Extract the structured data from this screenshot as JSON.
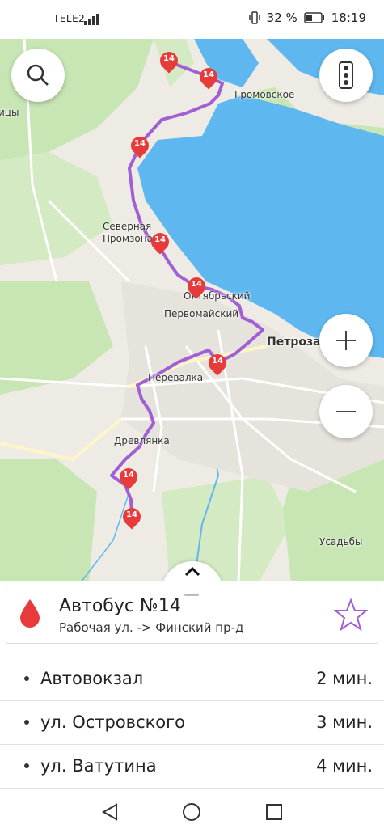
{
  "status_bar": {
    "carrier": "TELE2",
    "battery": "32 %",
    "time": "18:19"
  },
  "map": {
    "labels": {
      "gromovskoe": "Громовское",
      "severnaya_1": "Северная",
      "severnaya_2": "Промзона",
      "oktyabrsky": "Октябрьский",
      "pervomaysky": "Первомайский",
      "petrozavodsk": "Петрозаводск",
      "perevalka": "Перевалка",
      "drevlyanka": "Древлянка",
      "usadby": "Усадьбы",
      "left_edge": "ицы"
    },
    "stop_number": "14",
    "colors": {
      "water": "#5fb7f0",
      "land": "#eeebe5",
      "forest": "#c7e6b4",
      "route": "#a15fd6",
      "stop": "#e73a3a"
    }
  },
  "route_card": {
    "title": "Автобус №14",
    "subtitle": "Рабочая ул. -> Финский пр-д"
  },
  "stops": [
    {
      "name": "Автовокзал",
      "time": "2 мин."
    },
    {
      "name": "ул. Островского",
      "time": "3 мин."
    },
    {
      "name": "ул. Ватутина",
      "time": "4 мин."
    }
  ]
}
